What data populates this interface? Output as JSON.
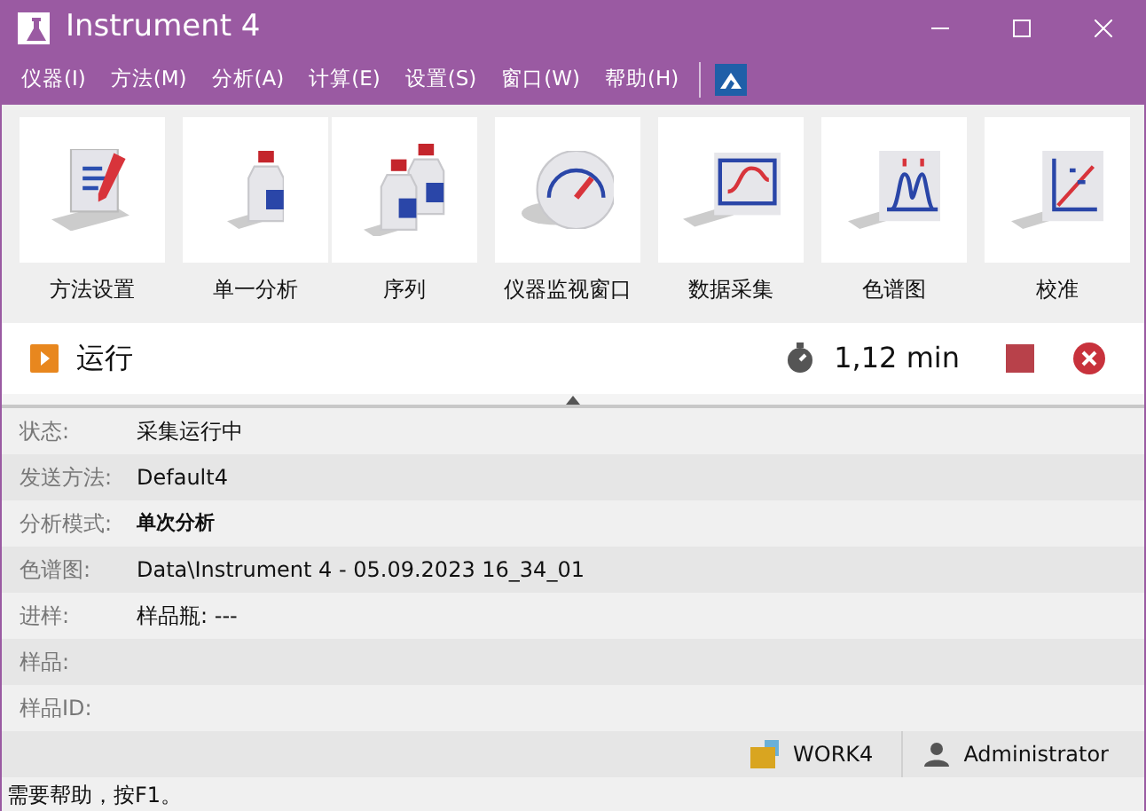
{
  "window": {
    "title": "Instrument 4"
  },
  "menu": [
    "仪器(I)",
    "方法(M)",
    "分析(A)",
    "计算(E)",
    "设置(S)",
    "窗口(W)",
    "帮助(H)"
  ],
  "toolbar": [
    {
      "label": "方法设置",
      "kind": "method"
    },
    {
      "label": "单一分析",
      "kind": "single"
    },
    {
      "label": "序列",
      "kind": "sequence"
    },
    {
      "label": "仪器监视窗口",
      "kind": "gauge"
    },
    {
      "label": "数据采集",
      "kind": "acquisition"
    },
    {
      "label": "色谱图",
      "kind": "chromatogram"
    },
    {
      "label": "校准",
      "kind": "calibration"
    }
  ],
  "run_bar": {
    "title": "运行",
    "elapsed": "1,12 min"
  },
  "info": [
    {
      "label": "状态:",
      "value": "采集运行中",
      "bold": false
    },
    {
      "label": "发送方法:",
      "value": "Default4",
      "bold": false
    },
    {
      "label": "分析模式:",
      "value": "单次分析",
      "bold": true
    },
    {
      "label": "色谱图:",
      "value": "Data\\Instrument 4 - 05.09.2023 16_34_01",
      "bold": false
    },
    {
      "label": "进样:",
      "value": "样品瓶: ---",
      "bold": false
    },
    {
      "label": "样品:"
    },
    {
      "label": "样品ID:"
    }
  ],
  "footer": {
    "project": "WORK4",
    "user": "Administrator"
  },
  "status_bar": "需要帮助，按F1。"
}
